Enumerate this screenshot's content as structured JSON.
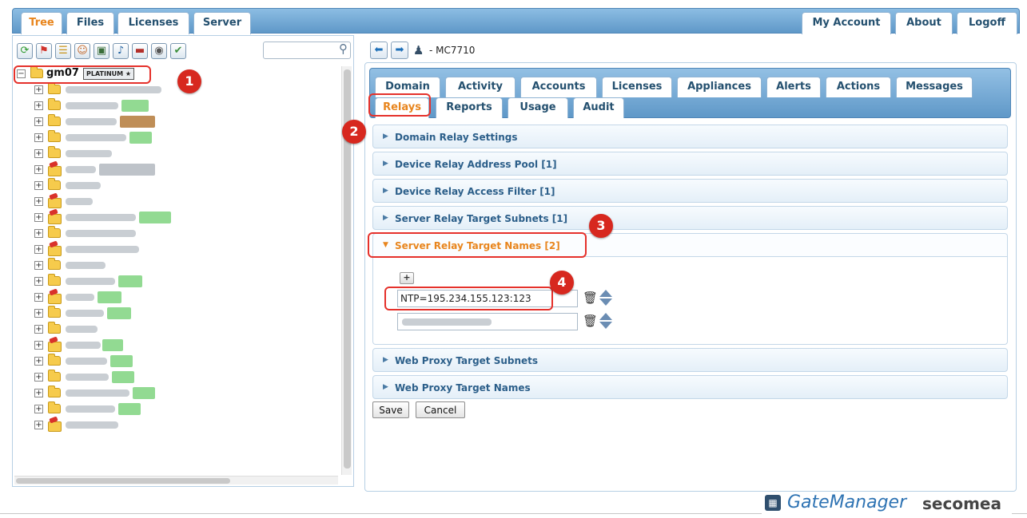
{
  "top_tabs": [
    {
      "label": "Tree",
      "active": true
    },
    {
      "label": "Files",
      "active": false
    },
    {
      "label": "Licenses",
      "active": false
    },
    {
      "label": "Server",
      "active": false
    }
  ],
  "top_links": [
    "My Account",
    "About",
    "Logoff"
  ],
  "toolbar_icons": [
    "refresh-icon",
    "domain-flag-icon",
    "tree-view-icon",
    "user-icon",
    "appliance-icon",
    "alarm-bell-icon",
    "toolbox-icon",
    "eye-icon",
    "checkmark-icon"
  ],
  "search": {
    "placeholder": "",
    "value": ""
  },
  "tree": {
    "root": {
      "label": "gm07",
      "badge": "PLATINUM ★"
    }
  },
  "breadcrumb": {
    "text": "- MC7710"
  },
  "domain_tabs_row1": [
    "Domain",
    "Activity",
    "Accounts",
    "Licenses",
    "Appliances",
    "Alerts",
    "Actions",
    "Messages"
  ],
  "domain_tabs_row2": [
    {
      "label": "Relays",
      "active": true
    },
    {
      "label": "Reports",
      "active": false
    },
    {
      "label": "Usage",
      "active": false
    },
    {
      "label": "Audit",
      "active": false
    }
  ],
  "sections": [
    "Domain Relay Settings",
    "Device Relay Address Pool [1]",
    "Device Relay Access Filter [1]",
    "Server Relay Target Subnets [1]",
    "Server Relay Target Names [2]",
    "Web Proxy Target Subnets",
    "Web Proxy Target Names"
  ],
  "target_names": {
    "add_label": "+",
    "entries": [
      "NTP=195.234.155.123:123",
      ""
    ]
  },
  "buttons": {
    "save": "Save",
    "cancel": "Cancel"
  },
  "callouts": [
    "1",
    "2",
    "3",
    "4"
  ],
  "brand": {
    "product": "GateManager",
    "maker": "secomea"
  },
  "colors": {
    "accent": "#e8851d",
    "tab_band": "#5f98c8",
    "callout": "#d7281f",
    "badge_green": "#7fd37f"
  }
}
